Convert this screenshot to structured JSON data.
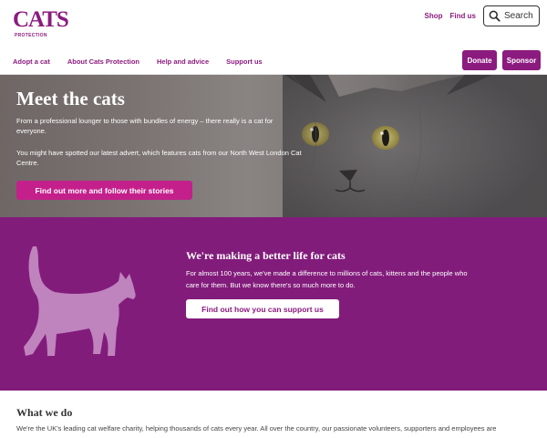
{
  "header": {
    "logo": {
      "wordmark": "CATS",
      "subtext": "PROTECTION"
    },
    "utility": {
      "shop": "Shop",
      "find_us": "Find us"
    },
    "search": {
      "placeholder": "Search",
      "icon": "search-icon"
    },
    "nav": [
      "Adopt a cat",
      "About Cats Protection",
      "Help and advice",
      "Support us"
    ],
    "donate_label": "Donate",
    "sponsor_label": "Sponsor"
  },
  "hero": {
    "title": "Meet the cats",
    "p1": "From a professional lounger to those with bundles of energy – there really is a cat for everyone.",
    "p2": "You might have spotted our latest advert, which features cats from our North West London Cat Centre.",
    "button": "Find out more and follow their stories"
  },
  "band": {
    "title": "We're making a better life for cats",
    "text": "For almost 100 years, we've made a difference to millions of cats, kittens and the people who care for them. But we know there's so much more to do.",
    "button": "Find out how you can support us"
  },
  "what_we_do": {
    "title": "What we do",
    "text": "We're the UK's leading cat welfare charity, helping thousands of cats every year. All over the country, our passionate volunteers, supporters and employees are"
  },
  "colors": {
    "brand_purple": "#8b1b7e",
    "band_purple": "#821c7b",
    "hero_button": "#c4208b"
  }
}
